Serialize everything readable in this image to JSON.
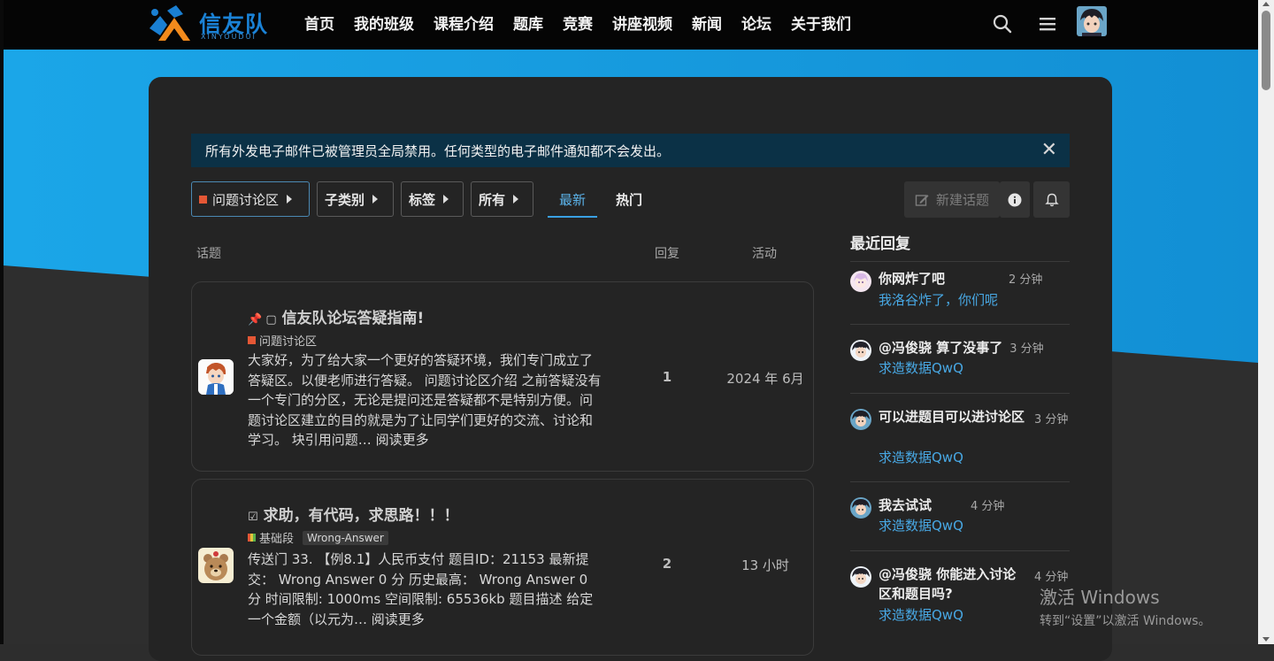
{
  "brand": {
    "name": "信友队",
    "sub": "XINYOUDUI"
  },
  "nav": [
    "首页",
    "我的班级",
    "课程介绍",
    "题库",
    "竞赛",
    "讲座视频",
    "新闻",
    "论坛",
    "关于我们"
  ],
  "icons": {
    "search": "search-icon",
    "menu": "hamburger-menu-icon",
    "close": "close-icon",
    "info": "info-icon",
    "bell": "bell-icon",
    "edit": "edit-icon"
  },
  "colors": {
    "accent": "#3aa0e3",
    "link": "#48a8e4",
    "category_orange": "#e45735",
    "notice_bg": "#0b3146"
  },
  "notice": {
    "text": "所有外发电子邮件已被管理员全局禁用。任何类型的电子邮件通知都不会发出。",
    "close": "✕"
  },
  "filters": {
    "category": "问题讨论区",
    "subcategory": "子类别",
    "tags": "标签",
    "all": "所有"
  },
  "tabs": {
    "latest": "最新",
    "hot": "热门"
  },
  "actions": {
    "new_topic": "新建话题"
  },
  "columns": {
    "topic": "话题",
    "replies": "回复",
    "activity": "活动"
  },
  "topics": [
    {
      "title": "信友队论坛答疑指南!",
      "prefix": "📌 ▢",
      "category": "问题讨论区",
      "excerpt": "大家好，为了给大家一个更好的答疑环境，我们专门成立了答疑区。以便老师进行答疑。 问题讨论区介绍 之前答疑没有一个专门的分区，无论是提问还是答疑都不是特别方便。问题讨论区建立的目的就是为了让同学们更好的交流、讨论和学习。 块引用问题…",
      "read_more": "阅读更多",
      "replies": "1",
      "activity": "2024 年 6月"
    },
    {
      "title": "求助，有代码，求思路！！！",
      "prefix": "☑",
      "category": "基础段",
      "tag": "Wrong-Answer",
      "excerpt": "传送门 33. 【例8.1】人民币支付 题目ID：21153 最新提交： Wrong Answer 0 分 历史最高： Wrong Answer 0 分 时间限制: 1000ms 空间限制: 65536kb 题目描述 给定一个金额（以元为…",
      "read_more": "阅读更多",
      "replies": "2",
      "activity": "13 小时"
    }
  ],
  "sidebar": {
    "title": "最近回复",
    "replies": [
      {
        "title": "你网炸了吧",
        "time": "2 分钟",
        "sub": "我洛谷炸了，你们呢"
      },
      {
        "title": "@冯俊骁 算了没事了",
        "time": "3 分钟",
        "sub": "求造数据QwQ"
      },
      {
        "title": "可以进题目可以进讨论区",
        "time": "3 分钟",
        "sub": "求造数据QwQ"
      },
      {
        "title": "我去试试",
        "time": "4 分钟",
        "sub": "求造数据QwQ"
      },
      {
        "title": "@冯俊骁 你能进入讨论区和题目吗?",
        "time": "4 分钟",
        "sub": "求造数据QwQ"
      }
    ]
  },
  "watermark": {
    "line1": "激活 Windows",
    "line2": "转到“设置”以激活 Windows。"
  }
}
